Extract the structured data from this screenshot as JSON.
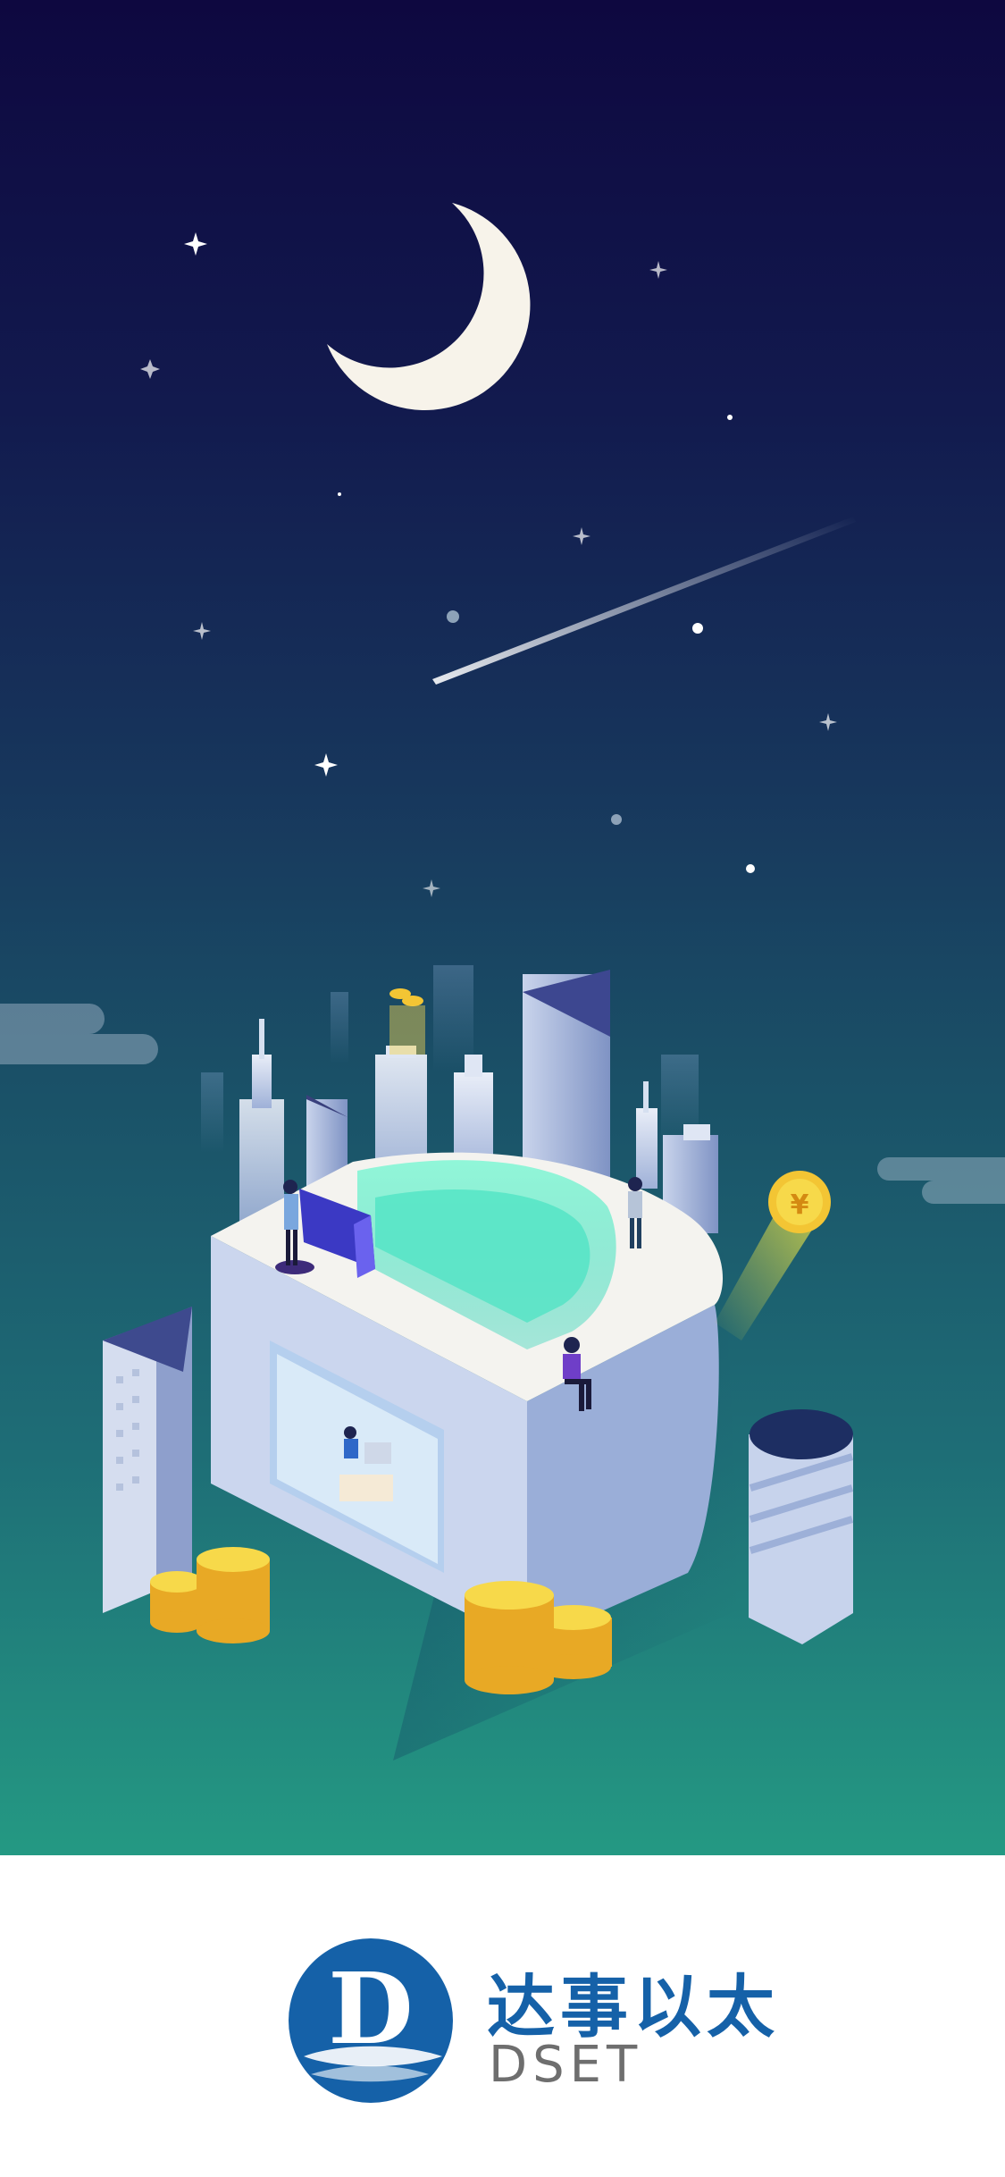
{
  "splash": {
    "coin_symbol": "¥",
    "brand_name_cn": "达事以太",
    "brand_name_en": "DSET",
    "logo_letter": "D"
  },
  "colors": {
    "sky_top": "#0e0840",
    "sky_bottom": "#249983",
    "moon": "#f7f3ea",
    "brand_blue": "#1561a8",
    "coin_gold": "#f3c534",
    "neon_cyan": "#5ef0c8"
  }
}
